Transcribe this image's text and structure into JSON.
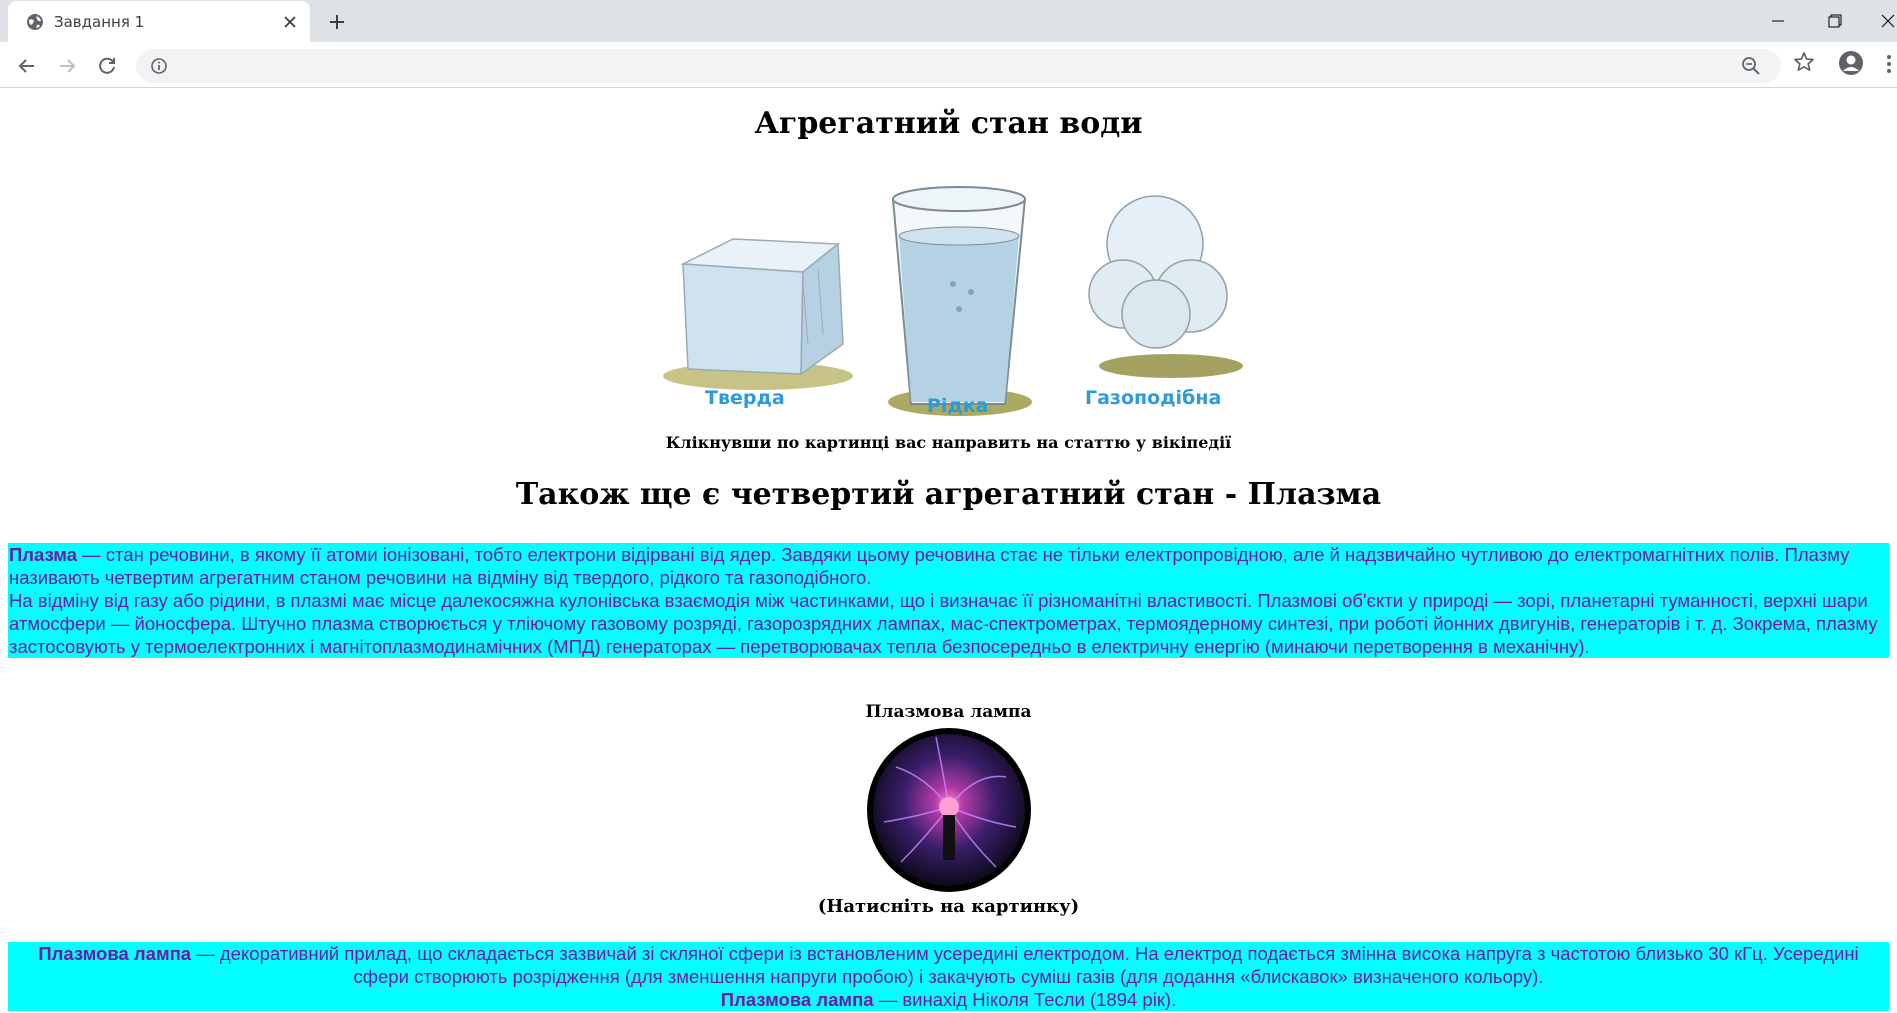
{
  "browser": {
    "tab_title": "Завдання 1"
  },
  "page": {
    "title": "Агрегатний стан води",
    "states": [
      {
        "label": "Тверда"
      },
      {
        "label": "Рідка"
      },
      {
        "label": "Газоподібна"
      }
    ],
    "caption": "Клікнувши по картинці вас направить на статтю у вікіпедії",
    "subtitle": "Також ще є четвертий агрегатний стан - Плазма",
    "plasma": {
      "term": "Плазма",
      "p1": " — стан речовини, в якому її атоми іонізовані, тобто електрони відірвані від ядер. Завдяки цьому речовина стає не тільки електропровідною, але й надзвичайно чутливою до електромагнітних полів. Плазму називають четвертим агрегатним станом речовини на відміну від твердого, рідкого та газоподібного.",
      "p2": "На відміну від газу або рідини, в плазмі має місце далекосяжна кулонівська взаємодія між частинками, що і визначає її різноманітні властивості. Плазмові об'єкти у природі — зорі, планетарні туманності, верхні шари атмосфери — йоносфера. Штучно плазма створюється у тліючому газовому розряді, газорозрядних лампах, мас-спектрометрах, термоядерному синтезі, при роботі йонних двигунів, генераторів і т. д. Зокрема, плазму застосовують у термоелектронних і магнітоплазмодинамічних (МПД) генераторах — перетворювачах тепла безпосередньо в електричну енергію (минаючи перетворення в механічну)."
    },
    "lamp": {
      "title": "Плазмова лампа",
      "hint": "(Натисніть на картинку)",
      "term": "Плазмова лампа",
      "p1": " — декоративний прилад, що складається зазвичай зі скляної сфери із встановленим усередині електродом. На електрод подається змінна висока напруга з частотою близько 30 кГц. Усередині сфери створюють розрідження (для зменшення напруги пробою) і закачують суміш газів (для додання «блискавок» визначеного кольору).",
      "term2": "Плазмова лампа",
      "p2": " — винахід Ніколя Тесли (1894 рік)."
    }
  },
  "icons": {
    "favicon": "globe-icon",
    "tab_close": "close-icon",
    "new_tab": "plus-icon",
    "back": "arrow-left-icon",
    "forward": "arrow-right-icon",
    "reload": "reload-icon",
    "info": "info-icon",
    "zoom": "zoom-out-icon",
    "bookmark": "star-icon",
    "account": "avatar-icon",
    "menu": "kebab-menu-icon"
  },
  "colors": {
    "highlight_bg": "#00ffff",
    "text_purple": "#6a1ca8",
    "label_blue": "#2b9cd8"
  }
}
